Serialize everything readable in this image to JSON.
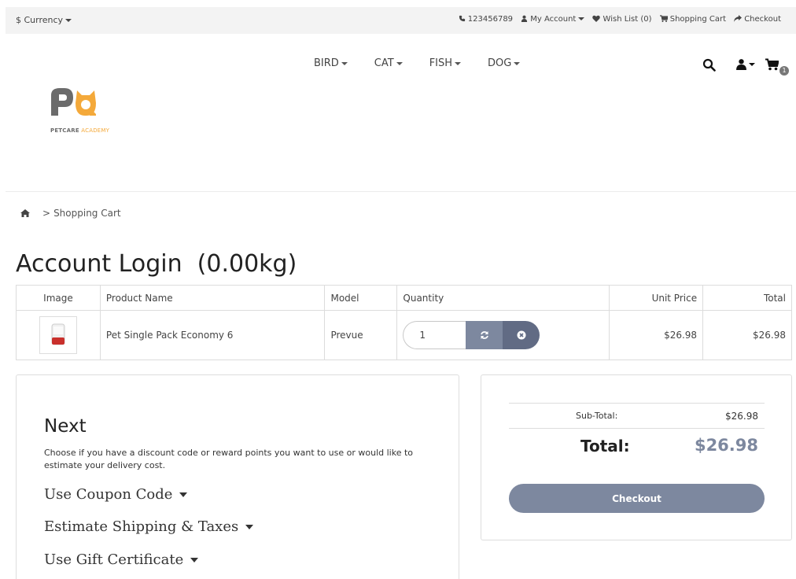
{
  "topbar": {
    "currency_label": "$ Currency",
    "phone": "123456789",
    "my_account": "My Account",
    "wish_list": "Wish List (0)",
    "shopping_cart": "Shopping Cart",
    "checkout": "Checkout"
  },
  "logo": {
    "text_a": "PETCARE",
    "text_b": "ACADEMY",
    "brand_gray": "#6b6b6b",
    "brand_orange": "#f4a93a"
  },
  "nav": {
    "items": [
      "BIRD",
      "CAT",
      "FISH",
      "DOG"
    ]
  },
  "header_icons": {
    "search": "search-icon",
    "user": "user-icon",
    "cart": "cart-icon",
    "cart_count": "1"
  },
  "breadcrumb": {
    "home_icon": "home-icon",
    "separator": ">",
    "current": "Shopping Cart"
  },
  "page": {
    "title": "Account Login  (0.00kg)"
  },
  "cart_table": {
    "headers": {
      "image": "Image",
      "product": "Product Name",
      "model": "Model",
      "quantity": "Quantity",
      "unit_price": "Unit Price",
      "total": "Total"
    },
    "rows": [
      {
        "product": "Pet Single Pack Economy 6",
        "model": "Prevue",
        "quantity": "1",
        "unit_price": "$26.98",
        "total": "$26.98"
      }
    ]
  },
  "next": {
    "title": "Next",
    "description": "Choose if you have a discount code or reward points you want to use or would like to estimate your delivery cost.",
    "links": [
      "Use Coupon Code",
      "Estimate Shipping & Taxes",
      "Use Gift Certificate"
    ]
  },
  "totals": {
    "subtotal_label": "Sub-Total:",
    "subtotal_value": "$26.98",
    "total_label": "Total:",
    "total_value": "$26.98",
    "checkout_button": "Checkout",
    "accent_color": "#7d889f"
  }
}
